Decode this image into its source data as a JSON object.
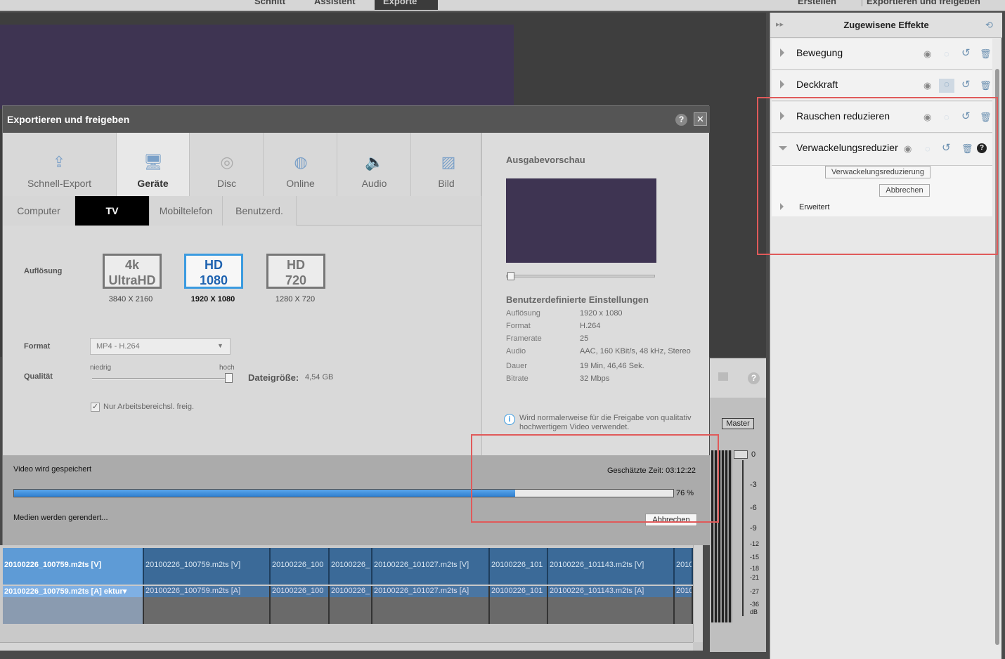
{
  "topbar": {
    "tabs": [
      "Schnitt",
      "Assistent",
      "Exporte",
      "Erstellen",
      "Exportieren und freigeben"
    ]
  },
  "effects_panel": {
    "title": "Zugewisene Effekte",
    "effects": [
      {
        "name": "Bewegung"
      },
      {
        "name": "Deckkraft"
      },
      {
        "name": "Rauschen reduzieren"
      },
      {
        "name": "Verwackelungsreduzier"
      }
    ],
    "stabilize_button": "Verwackelungsreduzierung",
    "cancel_button": "Abbrechen",
    "advanced_label": "Erweitert"
  },
  "dialog": {
    "title": "Exportieren und freigeben",
    "help_icon": "?",
    "close_icon": "✕",
    "categories": [
      "Schnell-Export",
      "Geräte",
      "Disc",
      "Online",
      "Audio",
      "Bild"
    ],
    "selected_category": "Geräte",
    "subtabs": [
      "Computer",
      "TV",
      "Mobiltelefon",
      "Benutzerd."
    ],
    "selected_subtab": "TV",
    "resolution_label": "Auflösung",
    "resolutions": [
      {
        "line1": "4k",
        "line2": "UltraHD",
        "dim": "3840 X 2160"
      },
      {
        "line1": "HD",
        "line2": "1080",
        "dim": "1920 X 1080"
      },
      {
        "line1": "HD",
        "line2": "720",
        "dim": "1280 X 720"
      }
    ],
    "format_label": "Format",
    "format_value": "MP4 - H.264",
    "quality_label": "Qualität",
    "quality_low": "niedrig",
    "quality_high": "hoch",
    "filesize_label": "Dateigröße:",
    "filesize_value": "4,54 GB",
    "workarea_checkbox": "Nur Arbeitsbereichsl. freig.",
    "preview_title": "Ausgabevorschau",
    "settings_title": "Benutzerdefinierte Einstellungen",
    "settings": [
      {
        "k": "Auflösung",
        "v": "1920 x 1080"
      },
      {
        "k": "Format",
        "v": "H.264"
      },
      {
        "k": "Framerate",
        "v": "25"
      },
      {
        "k": "Audio",
        "v": "AAC, 160 KBit/s, 48 kHz, Stereo"
      },
      {
        "k": "Dauer",
        "v": "19 Min, 46,46 Sek."
      },
      {
        "k": "Bitrate",
        "v": "32 Mbps"
      }
    ],
    "info_text_1": "Wird normalerweise für die Freigabe von qualitativ",
    "info_text_2": "hochwertigem Video verwendet.",
    "progress_status": "Video wird gespeichert",
    "estimated_time": "Geschätzte Zeit: 03:12:22",
    "progress_percent_label": "76 %",
    "progress_fraction": 0.76,
    "render_status": "Medien werden gerendert...",
    "cancel_button": "Abbrechen"
  },
  "timeline": {
    "video_clips": [
      "20100226_100759.m2ts [V]",
      "20100226_100759.m2ts [V]",
      "20100226_100",
      "20100226_",
      "20100226_101027.m2ts [V]",
      "20100226_101",
      "20100226_101143.m2ts [V]",
      "2010"
    ],
    "audio_clips": [
      "20100226_100759.m2ts [A] ektur▾",
      "20100226_100759.m2ts [A]",
      "20100226_100",
      "20100226_",
      "20100226_101027.m2ts [A]",
      "20100226_101",
      "20100226_101143.m2ts [A]",
      "2010"
    ]
  },
  "meter": {
    "master_label": "Master",
    "scale": [
      "0",
      "-3",
      "-6",
      "-9",
      "-12",
      "-15",
      "-18",
      "-21",
      "-27",
      "-36",
      "dB"
    ]
  },
  "colors": {
    "accent": "#3b9be0",
    "progress": "#2f7fd0",
    "highlight_box": "#e05a5a"
  }
}
